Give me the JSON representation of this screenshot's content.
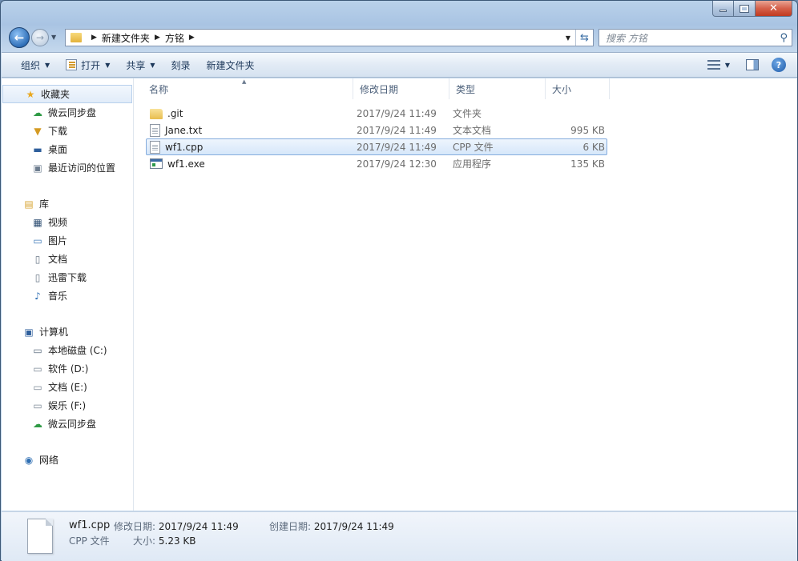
{
  "address": {
    "crumbs": [
      "新建文件夹",
      "方铭"
    ],
    "search_placeholder": "搜索 方铭"
  },
  "toolbar": {
    "organize": "组织",
    "open": "打开",
    "share": "共享",
    "burn": "刻录",
    "new_folder": "新建文件夹"
  },
  "sidebar": {
    "favorites": {
      "label": "收藏夹",
      "items": [
        "微云同步盘",
        "下载",
        "桌面",
        "最近访问的位置"
      ]
    },
    "libraries": {
      "label": "库",
      "items": [
        "视频",
        "图片",
        "文档",
        "迅雷下载",
        "音乐"
      ]
    },
    "computer": {
      "label": "计算机",
      "items": [
        "本地磁盘 (C:)",
        "软件 (D:)",
        "文档 (E:)",
        "娱乐 (F:)",
        "微云同步盘"
      ]
    },
    "network": {
      "label": "网络"
    }
  },
  "columns": {
    "name": "名称",
    "modified": "修改日期",
    "type": "类型",
    "size": "大小"
  },
  "files": [
    {
      "name": ".git",
      "modified": "2017/9/24 11:49",
      "type": "文件夹",
      "size": "",
      "icon": "folder-icon"
    },
    {
      "name": "Jane.txt",
      "modified": "2017/9/24 11:49",
      "type": "文本文档",
      "size": "995 KB",
      "icon": "text-file-icon"
    },
    {
      "name": "wf1.cpp",
      "modified": "2017/9/24 11:49",
      "type": "CPP 文件",
      "size": "6 KB",
      "icon": "cpp-file-icon",
      "selected": true
    },
    {
      "name": "wf1.exe",
      "modified": "2017/9/24 12:30",
      "type": "应用程序",
      "size": "135 KB",
      "icon": "exe-file-icon"
    }
  ],
  "details": {
    "name": "wf1.cpp",
    "type": "CPP 文件",
    "modified_label": "修改日期:",
    "modified_value": "2017/9/24 11:49",
    "created_label": "创建日期:",
    "created_value": "2017/9/24 11:49",
    "size_label": "大小:",
    "size_value": "5.23 KB"
  }
}
